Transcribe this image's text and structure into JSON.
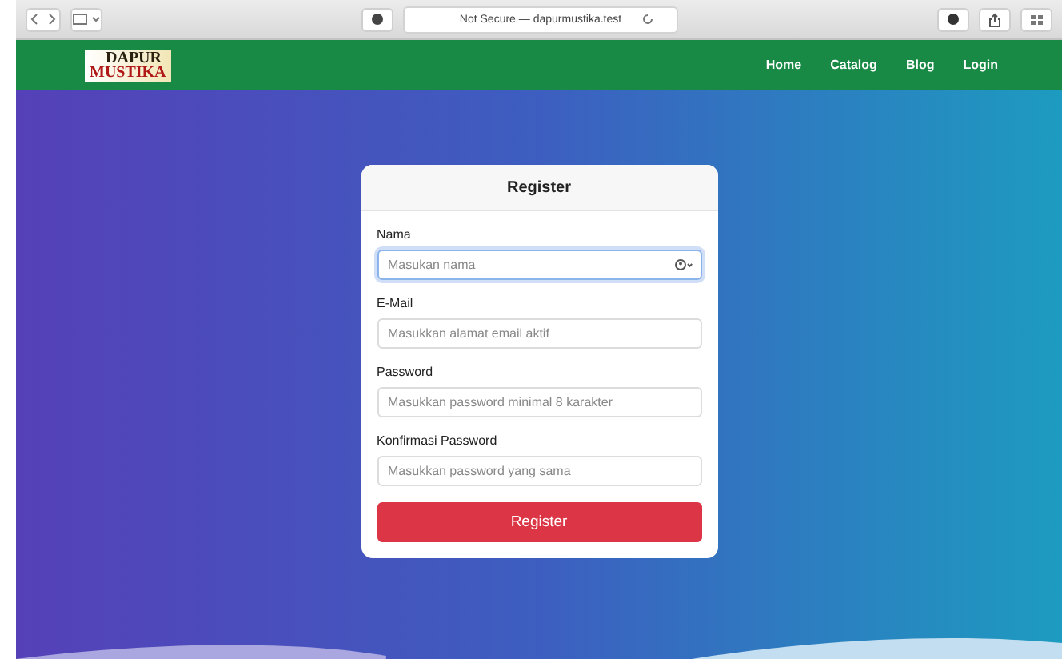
{
  "browser": {
    "address": "Not Secure — dapurmustika.test"
  },
  "logo": {
    "line_1": "DAPUR",
    "line_2": "MUSTIKA"
  },
  "nav": [
    {
      "label": "Home"
    },
    {
      "label": "Catalog"
    },
    {
      "label": "Blog"
    },
    {
      "label": "Login"
    }
  ],
  "form": {
    "title": "Register",
    "fields": [
      {
        "label": "Nama",
        "placeholder": "Masukan nama",
        "focused": true
      },
      {
        "label": "E-Mail",
        "placeholder": "Masukkan alamat email aktif",
        "focused": false
      },
      {
        "label": "Password",
        "placeholder": "Masukkan password minimal 8 karakter",
        "focused": false
      },
      {
        "label": "Konfirmasi Password",
        "placeholder": "Masukkan password yang sama",
        "focused": false
      }
    ],
    "button": "Register"
  }
}
